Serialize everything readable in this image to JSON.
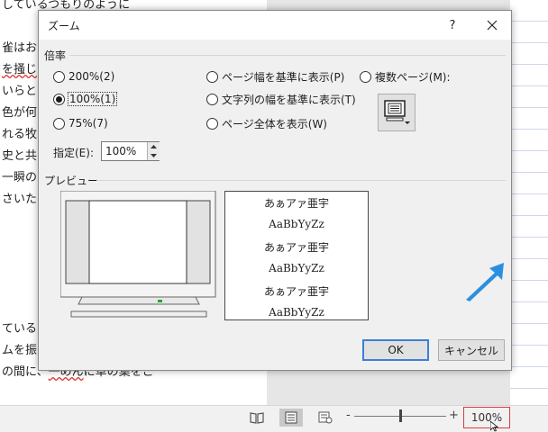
{
  "document": {
    "lines": [
      {
        "parts": [
          {
            "t": "しているつもりのように",
            "sq": false
          }
        ]
      },
      {
        "parts": [
          {
            "t": "",
            "sq": false
          }
        ]
      },
      {
        "parts": [
          {
            "t": "雀はお",
            "sq": false
          }
        ]
      },
      {
        "parts": [
          {
            "t": "を掻じ",
            "sq": true
          }
        ]
      },
      {
        "parts": [
          {
            "t": "いらと",
            "sq": false
          }
        ]
      },
      {
        "parts": [
          {
            "t": "色が何",
            "sq": false
          }
        ]
      },
      {
        "parts": [
          {
            "t": "れる牧",
            "sq": false
          }
        ]
      },
      {
        "parts": [
          {
            "t": "史と共",
            "sq": false
          }
        ]
      },
      {
        "parts": [
          {
            "t": "一瞬の",
            "sq": false
          }
        ]
      },
      {
        "parts": [
          {
            "t": "さいた",
            "sq": false
          }
        ]
      },
      {
        "parts": [
          {
            "t": "",
            "sq": false
          }
        ]
      },
      {
        "parts": [
          {
            "t": "",
            "sq": false
          }
        ]
      },
      {
        "parts": [
          {
            "t": "",
            "sq": false
          }
        ]
      },
      {
        "parts": [
          {
            "t": "",
            "sq": false
          }
        ]
      },
      {
        "parts": [
          {
            "t": "",
            "sq": false
          }
        ]
      },
      {
        "parts": [
          {
            "t": "ている",
            "sq": false
          }
        ]
      },
      {
        "parts": [
          {
            "t": "ムを振",
            "sq": false
          }
        ]
      },
      {
        "parts": [
          {
            "t": "の間に、",
            "sq": false
          },
          {
            "t": "一めん",
            "sq": true
          },
          {
            "t": "に草の葉をこ",
            "sq": false
          }
        ]
      }
    ]
  },
  "dialog": {
    "title": "ズーム",
    "help": "?",
    "magnification_label": "倍率",
    "options_left": [
      {
        "label": "200%(2)",
        "checked": false
      },
      {
        "label": "100%(1)",
        "checked": true
      },
      {
        "label": "75%(7)",
        "checked": false
      }
    ],
    "options_middle": [
      {
        "label": "ページ幅を基準に表示(P)",
        "checked": false
      },
      {
        "label": "文字列の幅を基準に表示(T)",
        "checked": false
      },
      {
        "label": "ページ全体を表示(W)",
        "checked": false
      }
    ],
    "option_multipage": {
      "label": "複数ページ(M):",
      "checked": false
    },
    "specify_label": "指定(E):",
    "specify_value": "100%",
    "preview_label": "プレビュー",
    "preview_lines": [
      "あぁアァ亜宇",
      "AaBbYyZz",
      "あぁアァ亜宇",
      "AaBbYyZz",
      "あぁアァ亜宇",
      "AaBbYyZz"
    ],
    "ok_label": "OK",
    "cancel_label": "キャンセル"
  },
  "statusbar": {
    "zoom_percent": "100%",
    "zoom_minus": "-",
    "zoom_plus": "+",
    "zoom_level": 0.5
  },
  "colors": {
    "accent_blue": "#3c7fd8",
    "highlight_red": "#e0393e",
    "arrow_blue": "#2b8fe0"
  }
}
